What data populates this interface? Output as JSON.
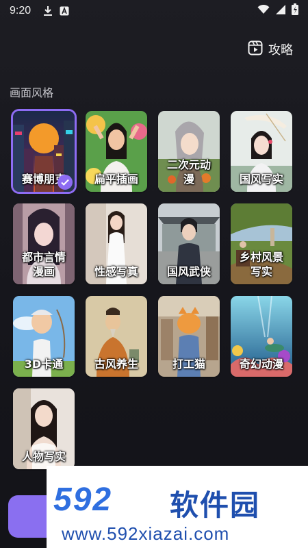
{
  "status": {
    "time": "9:20"
  },
  "header": {
    "guide_label": "攻略"
  },
  "section": {
    "title": "画面风格"
  },
  "styles": [
    {
      "label": "赛博朋克",
      "selected": true
    },
    {
      "label": "扁平插画",
      "selected": false
    },
    {
      "label": "二次元动\n漫",
      "selected": false
    },
    {
      "label": "国风写实",
      "selected": false
    },
    {
      "label": "都市言情\n漫画",
      "selected": false
    },
    {
      "label": "性感写真",
      "selected": false
    },
    {
      "label": "国风武侠",
      "selected": false
    },
    {
      "label": "乡村风景\n写实",
      "selected": false
    },
    {
      "label": "3D卡通",
      "selected": false
    },
    {
      "label": "古风养生",
      "selected": false
    },
    {
      "label": "打工猫",
      "selected": false
    },
    {
      "label": "奇幻动漫",
      "selected": false
    },
    {
      "label": "人物写实",
      "selected": false
    }
  ],
  "watermark": {
    "logo": "592",
    "name": "软件园",
    "url": "www.592xiazai.com"
  },
  "colors": {
    "accent": "#8d6cf3",
    "background": "#1b1b21"
  }
}
